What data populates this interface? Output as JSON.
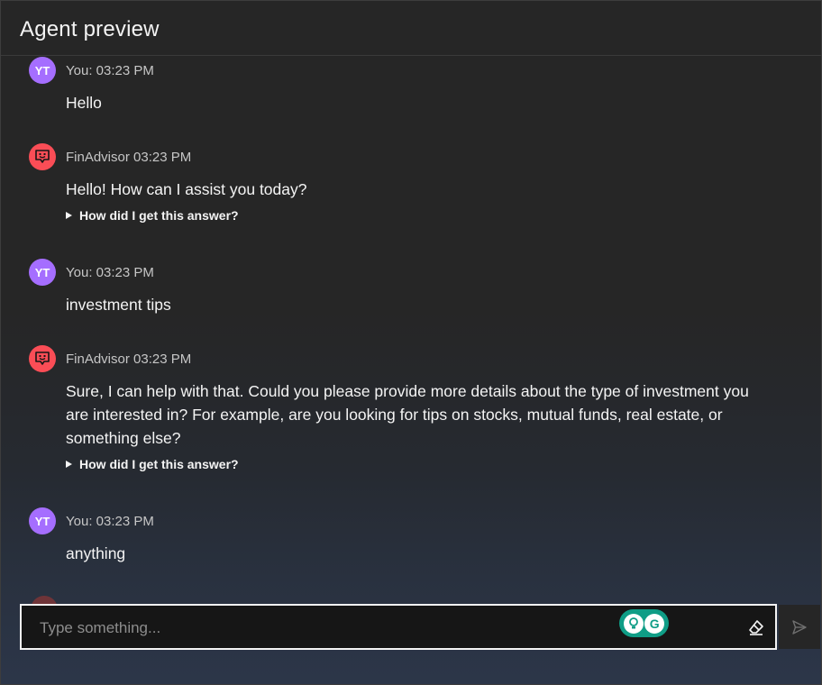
{
  "header": {
    "title": "Agent preview"
  },
  "messages": [
    {
      "sender": "user",
      "initials": "YT",
      "meta": "You: 03:23 PM",
      "text": "Hello"
    },
    {
      "sender": "bot",
      "meta": "FinAdvisor 03:23 PM",
      "text": "Hello! How can I assist you today?",
      "explain_label": "How did I get this answer?"
    },
    {
      "sender": "user",
      "initials": "YT",
      "meta": "You: 03:23 PM",
      "text": "investment tips"
    },
    {
      "sender": "bot",
      "meta": "FinAdvisor 03:23 PM",
      "text": "Sure, I can help with that. Could you please provide more details about the type of investment you are interested in? For example, are you looking for tips on stocks, mutual funds, real estate, or something else?",
      "explain_label": "How did I get this answer?"
    },
    {
      "sender": "user",
      "initials": "YT",
      "meta": "You: 03:23 PM",
      "text": "anything"
    }
  ],
  "composer": {
    "placeholder": "Type something...",
    "value": ""
  },
  "icons": {
    "bot_avatar": "bot-face-icon",
    "grammarly": "grammarly-icon",
    "clear": "eraser-icon",
    "send": "send-icon"
  },
  "colors": {
    "user_avatar": "#a56eff",
    "bot_avatar": "#fa4d56",
    "accent": "#1f5fd1"
  }
}
